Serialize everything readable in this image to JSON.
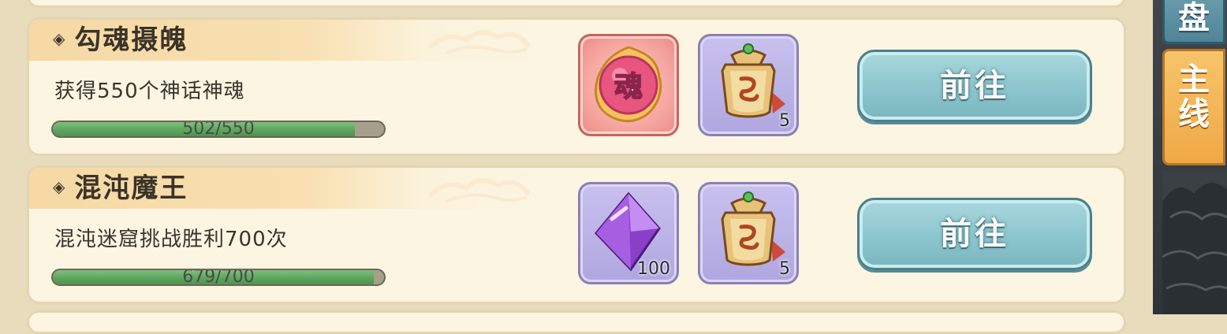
{
  "tasks": [
    {
      "title": "勾魂摄魄",
      "description": "获得550个神话神魂",
      "progress_text": "502/550",
      "progress_value": 502,
      "progress_max": 550,
      "rewards": [
        {
          "icon": "soul-orb-icon",
          "char": "魂",
          "quantity": ""
        },
        {
          "icon": "token-plaque-icon",
          "quantity": "5"
        }
      ],
      "button_label": "前往"
    },
    {
      "title": "混沌魔王",
      "description": "混沌迷窟挑战胜利700次",
      "progress_text": "679/700",
      "progress_value": 679,
      "progress_max": 700,
      "rewards": [
        {
          "icon": "purple-crystal-icon",
          "quantity": "100"
        },
        {
          "icon": "token-plaque-icon",
          "quantity": "5"
        }
      ],
      "button_label": "前往"
    }
  ],
  "side_tabs": {
    "top_partial": "盘",
    "main_line_1": "主",
    "main_line_2": "线"
  },
  "colors": {
    "card_bg": "#fbf5e1",
    "progress_fill": "#5ba35d",
    "button_bg": "#8cc5cd",
    "active_tab": "#f0a845"
  }
}
